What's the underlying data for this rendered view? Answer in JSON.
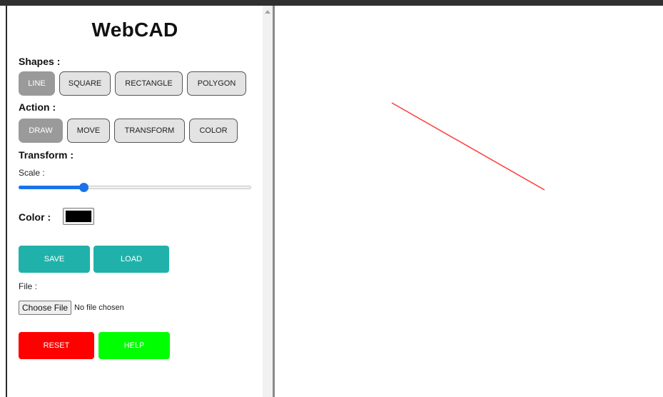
{
  "app": {
    "title": "WebCAD"
  },
  "shapes": {
    "label": "Shapes :",
    "buttons": [
      "LINE",
      "SQUARE",
      "RECTANGLE",
      "POLYGON"
    ],
    "active": "LINE"
  },
  "action": {
    "label": "Action :",
    "buttons": [
      "DRAW",
      "MOVE",
      "TRANSFORM",
      "COLOR"
    ],
    "active": "DRAW"
  },
  "transform": {
    "label": "Transform :",
    "scale_label": "Scale :",
    "scale_fraction": 0.28
  },
  "color": {
    "label": "Color :",
    "value": "#000000"
  },
  "file_actions": {
    "save_label": "SAVE",
    "load_label": "LOAD",
    "file_label": "File :",
    "choose_file_label": "Choose File",
    "file_status": "No file chosen"
  },
  "bottom_actions": {
    "reset_label": "RESET",
    "help_label": "HELP"
  },
  "colors": {
    "teal": "#20b2aa",
    "reset": "#ff0000",
    "help": "#00ff00",
    "line": "#ff3b3b"
  },
  "canvas": {
    "shapes": [
      {
        "type": "line",
        "color": "#ff3b3b"
      }
    ]
  }
}
